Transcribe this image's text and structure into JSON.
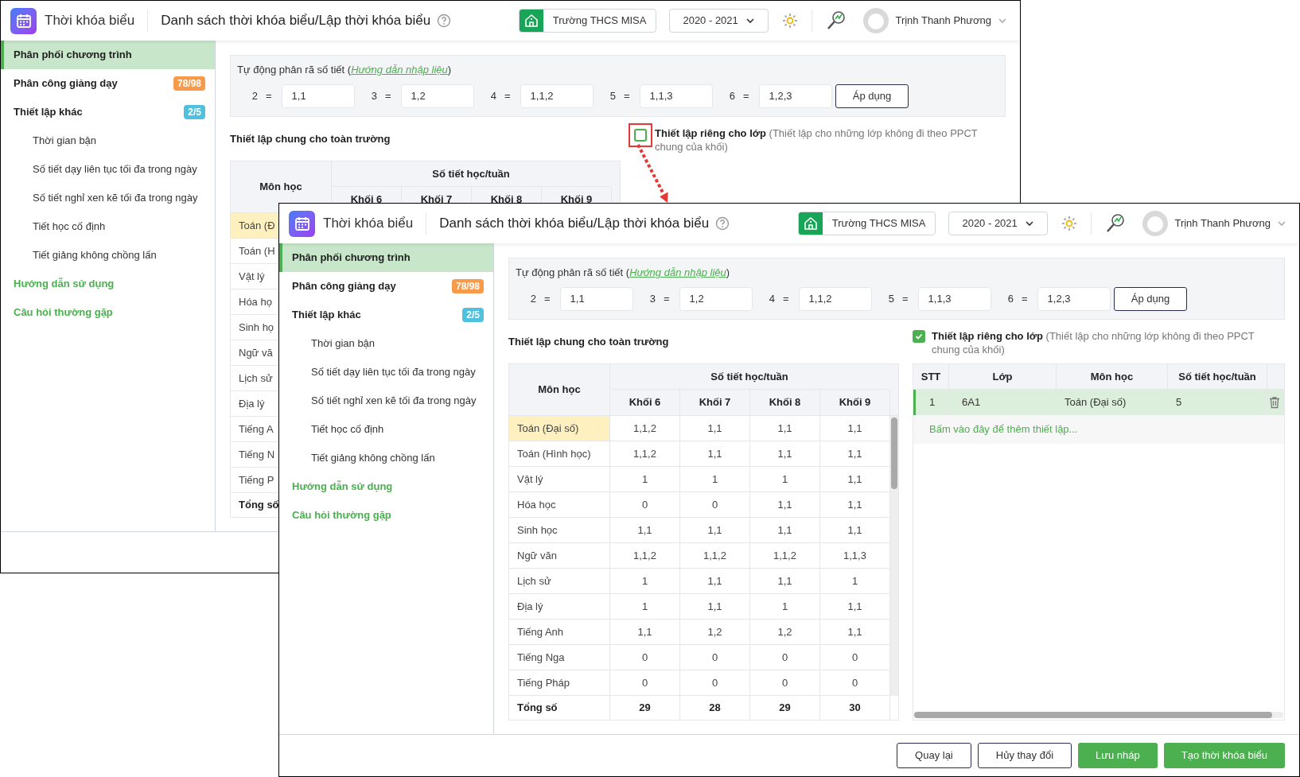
{
  "windows": [
    {
      "app_title": "Thời khóa biểu",
      "page_title": "Danh sách thời khóa biểu/Lập thời khóa biểu",
      "school": "Trường THCS MISA",
      "year": "2020 - 2021",
      "user": "Trịnh Thanh Phương",
      "sidebar": [
        {
          "label": "Phân phối chương trình",
          "kind": "section",
          "selected": true
        },
        {
          "label": "Phân công giảng dạy",
          "kind": "section",
          "selected": false,
          "badge": "78/98",
          "color": "#f79a4a"
        },
        {
          "label": "Thiết lập khác",
          "kind": "section",
          "selected": false,
          "badge": "2/5",
          "color": "#4fc0de"
        },
        {
          "label": "Thời gian bận",
          "kind": "sub",
          "selected": false
        },
        {
          "label": "Số tiết dạy liên tục tối đa trong ngày",
          "kind": "sub",
          "selected": false
        },
        {
          "label": "Số tiết nghỉ xen kẽ tối đa trong ngày",
          "kind": "sub",
          "selected": false
        },
        {
          "label": "Tiết học cố định",
          "kind": "sub",
          "selected": false
        },
        {
          "label": "Tiết giảng không chồng lấn",
          "kind": "sub",
          "selected": false
        },
        {
          "label": "Hướng dẫn sử dụng",
          "kind": "link",
          "selected": false
        },
        {
          "label": "Câu hỏi thường gặp",
          "kind": "link",
          "selected": false
        }
      ],
      "auto_split": {
        "label_before": "Tự động phân rã số tiết (",
        "link": "Hướng dẫn nhập liệu",
        "label_after": ")",
        "pairs": [
          {
            "key": "2",
            "sign": "=",
            "value": "1,1"
          },
          {
            "key": "3",
            "sign": "=",
            "value": "1,2"
          },
          {
            "key": "4",
            "sign": "=",
            "value": "1,1,2"
          },
          {
            "key": "5",
            "sign": "=",
            "value": "1,1,3"
          },
          {
            "key": "6",
            "sign": "=",
            "value": "1,2,3"
          }
        ],
        "apply": "Áp dụng"
      },
      "general_title": "Thiết lập chung cho toàn trường",
      "class_setting": {
        "checked": false,
        "highlighted": true,
        "label": "Thiết lập riêng cho lớp",
        "note": "(Thiết lập cho những lớp không đi theo PPCT chung của khối)"
      },
      "general_table": {
        "subject_header": "Môn học",
        "group_header": "Số tiết học/tuần",
        "columns": [
          "Khối 6",
          "Khối 7",
          "Khối 8",
          "Khối 9"
        ],
        "rows": [
          {
            "subject": "Toán (Đ",
            "kind": "normal",
            "selected": true
          },
          {
            "subject": "Toán (H",
            "kind": "normal",
            "selected": false
          },
          {
            "subject": "Vật lý",
            "kind": "normal",
            "selected": false
          },
          {
            "subject": "Hóa họ",
            "kind": "normal",
            "selected": false
          },
          {
            "subject": "Sinh họ",
            "kind": "normal",
            "selected": false
          },
          {
            "subject": "Ngữ vă",
            "kind": "normal",
            "selected": false
          },
          {
            "subject": "Lịch sử",
            "kind": "normal",
            "selected": false
          },
          {
            "subject": "Địa lý",
            "kind": "normal",
            "selected": false
          },
          {
            "subject": "Tiếng A",
            "kind": "normal",
            "selected": false
          },
          {
            "subject": "Tiếng N",
            "kind": "normal",
            "selected": false
          },
          {
            "subject": "Tiếng P",
            "kind": "normal",
            "selected": false
          },
          {
            "subject": "Tổng số",
            "kind": "total",
            "selected": false
          }
        ]
      }
    },
    {
      "app_title": "Thời khóa biểu",
      "page_title": "Danh sách thời khóa biểu/Lập thời khóa biểu",
      "school": "Trường THCS MISA",
      "year": "2020 - 2021",
      "user": "Trịnh Thanh Phương",
      "sidebar": [
        {
          "label": "Phân phối chương trình",
          "kind": "section",
          "selected": true
        },
        {
          "label": "Phân công giảng dạy",
          "kind": "section",
          "selected": false,
          "badge": "78/98",
          "color": "#f79a4a"
        },
        {
          "label": "Thiết lập khác",
          "kind": "section",
          "selected": false,
          "badge": "2/5",
          "color": "#4fc0de"
        },
        {
          "label": "Thời gian bận",
          "kind": "sub",
          "selected": false
        },
        {
          "label": "Số tiết dạy liên tục tối đa trong ngày",
          "kind": "sub",
          "selected": false
        },
        {
          "label": "Số tiết nghỉ xen kẽ tối đa trong ngày",
          "kind": "sub",
          "selected": false
        },
        {
          "label": "Tiết học cố định",
          "kind": "sub",
          "selected": false
        },
        {
          "label": "Tiết giảng không chồng lấn",
          "kind": "sub",
          "selected": false
        },
        {
          "label": "Hướng dẫn sử dụng",
          "kind": "link",
          "selected": false
        },
        {
          "label": "Câu hỏi thường gặp",
          "kind": "link",
          "selected": false
        }
      ],
      "auto_split": {
        "label_before": "Tự động phân rã số tiết (",
        "link": "Hướng dẫn nhập liệu",
        "label_after": ")",
        "pairs": [
          {
            "key": "2",
            "sign": "=",
            "value": "1,1"
          },
          {
            "key": "3",
            "sign": "=",
            "value": "1,2"
          },
          {
            "key": "4",
            "sign": "=",
            "value": "1,1,2"
          },
          {
            "key": "5",
            "sign": "=",
            "value": "1,1,3"
          },
          {
            "key": "6",
            "sign": "=",
            "value": "1,2,3"
          }
        ],
        "apply": "Áp dụng"
      },
      "general_title": "Thiết lập chung cho toàn trường",
      "class_setting": {
        "checked": true,
        "label": "Thiết lập riêng cho lớp",
        "note": "(Thiết lập cho những lớp không đi theo PPCT chung của khối)"
      },
      "general_table": {
        "subject_header": "Môn học",
        "group_header": "Số tiết học/tuần",
        "columns": [
          "Khối 6",
          "Khối 7",
          "Khối 8",
          "Khối 9"
        ],
        "rows": [
          {
            "subject": "Toán (Đại số)",
            "kind": "normal",
            "selected": true,
            "values": [
              "1,1,2",
              "1,1",
              "1,1",
              "1,1"
            ]
          },
          {
            "subject": "Toán (Hình học)",
            "kind": "normal",
            "selected": false,
            "values": [
              "1,1,2",
              "1,1",
              "1,1",
              "1,1"
            ]
          },
          {
            "subject": "Vật lý",
            "kind": "normal",
            "selected": false,
            "values": [
              "1",
              "1",
              "1",
              "1,1"
            ]
          },
          {
            "subject": "Hóa học",
            "kind": "normal",
            "selected": false,
            "values": [
              "0",
              "0",
              "1,1",
              "1,1"
            ]
          },
          {
            "subject": "Sinh học",
            "kind": "normal",
            "selected": false,
            "values": [
              "1,1",
              "1,1",
              "1,1",
              "1,1"
            ]
          },
          {
            "subject": "Ngữ văn",
            "kind": "normal",
            "selected": false,
            "values": [
              "1,1,2",
              "1,1,2",
              "1,1,2",
              "1,1,3"
            ]
          },
          {
            "subject": "Lịch sử",
            "kind": "normal",
            "selected": false,
            "values": [
              "1",
              "1,1",
              "1,1",
              "1"
            ]
          },
          {
            "subject": "Địa lý",
            "kind": "normal",
            "selected": false,
            "values": [
              "1",
              "1,1",
              "1",
              "1,1"
            ]
          },
          {
            "subject": "Tiếng Anh",
            "kind": "normal",
            "selected": false,
            "values": [
              "1,1",
              "1,2",
              "1,2",
              "1,1"
            ]
          },
          {
            "subject": "Tiếng Nga",
            "kind": "normal",
            "selected": false,
            "values": [
              "0",
              "0",
              "0",
              "0"
            ]
          },
          {
            "subject": "Tiếng Pháp",
            "kind": "normal",
            "selected": false,
            "values": [
              "0",
              "0",
              "0",
              "0"
            ]
          },
          {
            "subject": "Tổng số",
            "kind": "total",
            "selected": false,
            "values": [
              "29",
              "28",
              "29",
              "30"
            ]
          }
        ]
      },
      "class_table": {
        "columns": [
          "STT",
          "Lớp",
          "Môn học",
          "Số tiết học/tuần"
        ],
        "rows": [
          {
            "stt": "1",
            "class": "6A1",
            "subject": "Toán (Đại số)",
            "periods": "5",
            "selected": true
          }
        ],
        "add_link": "Bấm vào đây để thêm thiết lập..."
      },
      "buttons": [
        {
          "label": "Quay lại",
          "kind": "outline"
        },
        {
          "label": "Hủy thay đổi",
          "kind": "outline"
        },
        {
          "label": "Lưu nháp",
          "kind": "primary"
        },
        {
          "label": "Tạo thời khóa biểu",
          "kind": "primary"
        }
      ]
    }
  ]
}
